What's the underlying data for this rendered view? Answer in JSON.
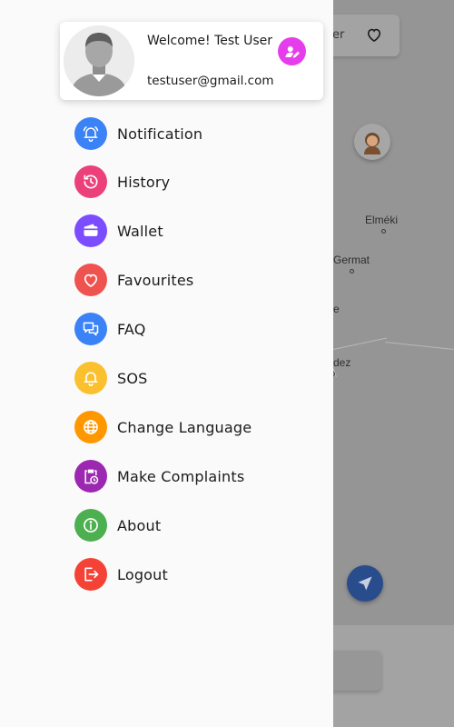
{
  "map": {
    "search_text": "er",
    "labels": [
      {
        "id": "elmeki",
        "text": "Elméki"
      },
      {
        "id": "germat",
        "text": "Germat"
      },
      {
        "id": "partial-e",
        "text": "e"
      },
      {
        "id": "dez",
        "text": "dez"
      },
      {
        "id": "partial-o",
        "text": "o"
      }
    ]
  },
  "profile": {
    "greeting": "Welcome! Test User",
    "email": "testuser@gmail.com"
  },
  "menu": {
    "items": [
      {
        "key": "notification",
        "label": "Notification",
        "color": "#3b82f6",
        "icon": "bell-ring-icon"
      },
      {
        "key": "history",
        "label": "History",
        "color": "#ec407a",
        "icon": "history-icon"
      },
      {
        "key": "wallet",
        "label": "Wallet",
        "color": "#7c4dff",
        "icon": "wallet-icon"
      },
      {
        "key": "favourites",
        "label": "Favourites",
        "color": "#ef5350",
        "icon": "heart-icon"
      },
      {
        "key": "faq",
        "label": "FAQ",
        "color": "#3b82f6",
        "icon": "chat-bubbles-icon"
      },
      {
        "key": "sos",
        "label": "SOS",
        "color": "#fbc02d",
        "icon": "alarm-bell-icon"
      },
      {
        "key": "change-language",
        "label": "Change Language",
        "color": "#ff9800",
        "icon": "globe-icon"
      },
      {
        "key": "make-complaints",
        "label": "Make Complaints",
        "color": "#9c27b0",
        "icon": "clipboard-clock-icon"
      },
      {
        "key": "about",
        "label": "About",
        "color": "#4caf50",
        "icon": "info-icon"
      },
      {
        "key": "logout",
        "label": "Logout",
        "color": "#f44336",
        "icon": "logout-icon"
      }
    ]
  },
  "colors": {
    "edit_button": "#e63dec",
    "nav_fab": "#294d8c"
  }
}
